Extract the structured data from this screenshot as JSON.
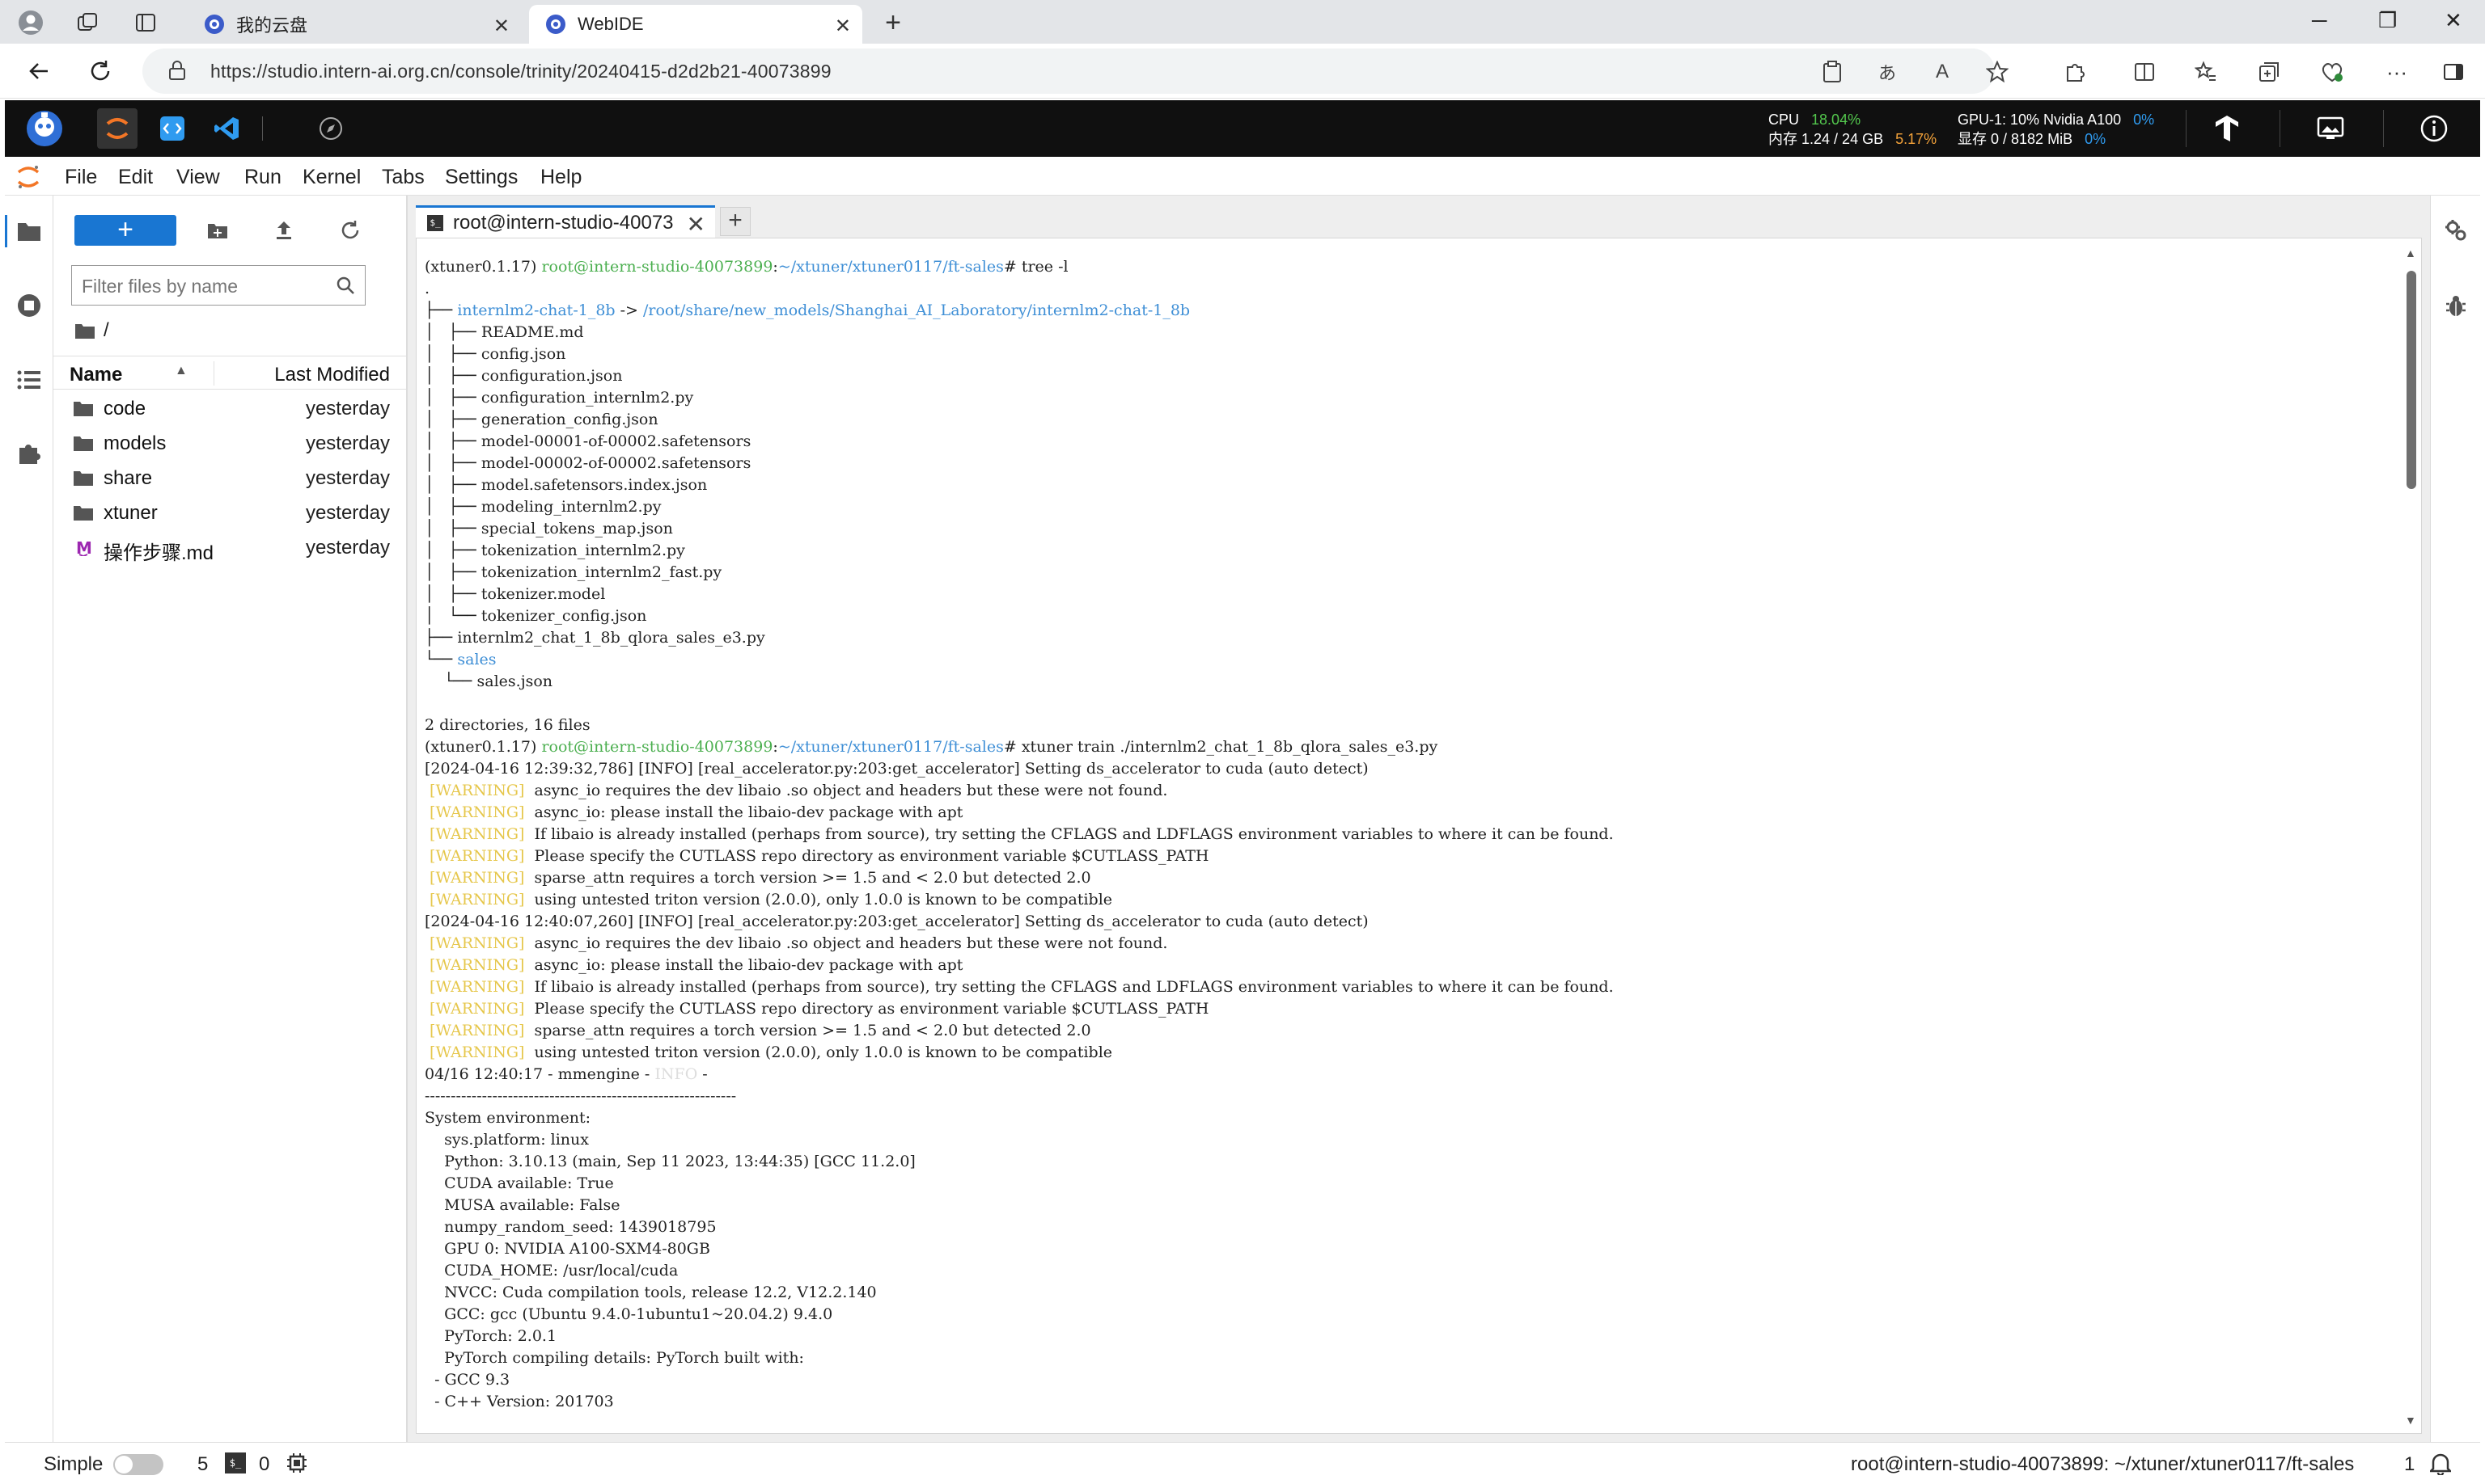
{
  "browser": {
    "tabs": [
      {
        "title": "我的云盘"
      },
      {
        "title": "WebIDE"
      }
    ],
    "url": "https://studio.intern-ai.org.cn/console/trinity/20240415-d2d2b21-40073899"
  },
  "topbar": {
    "cpu_label": "CPU",
    "cpu_value": "18.04%",
    "mem_label": "内存",
    "mem_value": "1.24 / 24 GB",
    "mem_percent": "5.17%",
    "gpu_label": "GPU-1: 10% Nvidia A100",
    "gpu_percent": "0%",
    "vram_label": "显存",
    "vram_value": "0 / 8182 MiB",
    "vram_percent": "0%"
  },
  "menu": {
    "items": [
      "File",
      "Edit",
      "View",
      "Run",
      "Kernel",
      "Tabs",
      "Settings",
      "Help"
    ]
  },
  "filebrowser": {
    "new_label": "+",
    "filter_placeholder": "Filter files by name",
    "breadcrumb": "/",
    "col_name": "Name",
    "col_modified": "Last Modified",
    "files": [
      {
        "name": "code",
        "modified": "yesterday",
        "type": "folder"
      },
      {
        "name": "models",
        "modified": "yesterday",
        "type": "folder"
      },
      {
        "name": "share",
        "modified": "yesterday",
        "type": "folder"
      },
      {
        "name": "xtuner",
        "modified": "yesterday",
        "type": "folder"
      },
      {
        "name": "操作步骤.md",
        "modified": "yesterday",
        "type": "markdown"
      }
    ]
  },
  "terminal": {
    "tab_title": "root@intern-studio-40073",
    "add_tab": "+",
    "lines": [
      {
        "segs": [
          {
            "t": "(xtuner0.1.17) "
          },
          {
            "t": "root@intern-studio-40073899",
            "c": "green"
          },
          {
            "t": ":"
          },
          {
            "t": "~/xtuner/xtuner0117/ft-sales",
            "c": "blue"
          },
          {
            "t": "# tree -l"
          }
        ]
      },
      {
        "segs": [
          {
            "t": "."
          }
        ]
      },
      {
        "segs": [
          {
            "t": "├── "
          },
          {
            "t": "internlm2-chat-1_8b",
            "c": "blue"
          },
          {
            "t": " -> "
          },
          {
            "t": "/root/share/new_models/Shanghai_AI_Laboratory/internlm2-chat-1_8b",
            "c": "blue"
          }
        ]
      },
      {
        "segs": [
          {
            "t": "│   ├── README.md"
          }
        ]
      },
      {
        "segs": [
          {
            "t": "│   ├── config.json"
          }
        ]
      },
      {
        "segs": [
          {
            "t": "│   ├── configuration.json"
          }
        ]
      },
      {
        "segs": [
          {
            "t": "│   ├── configuration_internlm2.py"
          }
        ]
      },
      {
        "segs": [
          {
            "t": "│   ├── generation_config.json"
          }
        ]
      },
      {
        "segs": [
          {
            "t": "│   ├── model-00001-of-00002.safetensors"
          }
        ]
      },
      {
        "segs": [
          {
            "t": "│   ├── model-00002-of-00002.safetensors"
          }
        ]
      },
      {
        "segs": [
          {
            "t": "│   ├── model.safetensors.index.json"
          }
        ]
      },
      {
        "segs": [
          {
            "t": "│   ├── modeling_internlm2.py"
          }
        ]
      },
      {
        "segs": [
          {
            "t": "│   ├── special_tokens_map.json"
          }
        ]
      },
      {
        "segs": [
          {
            "t": "│   ├── tokenization_internlm2.py"
          }
        ]
      },
      {
        "segs": [
          {
            "t": "│   ├── tokenization_internlm2_fast.py"
          }
        ]
      },
      {
        "segs": [
          {
            "t": "│   ├── tokenizer.model"
          }
        ]
      },
      {
        "segs": [
          {
            "t": "│   └── tokenizer_config.json"
          }
        ]
      },
      {
        "segs": [
          {
            "t": "├── internlm2_chat_1_8b_qlora_sales_e3.py"
          }
        ]
      },
      {
        "segs": [
          {
            "t": "└── "
          },
          {
            "t": "sales",
            "c": "blue"
          }
        ]
      },
      {
        "segs": [
          {
            "t": "    └── sales.json"
          }
        ]
      },
      {
        "segs": [
          {
            "t": ""
          }
        ]
      },
      {
        "segs": [
          {
            "t": "2 directories, 16 files"
          }
        ]
      },
      {
        "segs": [
          {
            "t": "(xtuner0.1.17) "
          },
          {
            "t": "root@intern-studio-40073899",
            "c": "green"
          },
          {
            "t": ":"
          },
          {
            "t": "~/xtuner/xtuner0117/ft-sales",
            "c": "blue"
          },
          {
            "t": "# xtuner train ./internlm2_chat_1_8b_qlora_sales_e3.py"
          }
        ]
      },
      {
        "segs": [
          {
            "t": "[2024-04-16 12:39:32,786] [INFO] [real_accelerator.py:203:get_accelerator] Setting ds_accelerator to cuda (auto detect)"
          }
        ]
      },
      {
        "segs": [
          {
            "t": " [WARNING]",
            "c": "yellow"
          },
          {
            "t": "  async_io requires the dev libaio .so object and headers but these were not found."
          }
        ]
      },
      {
        "segs": [
          {
            "t": " [WARNING]",
            "c": "yellow"
          },
          {
            "t": "  async_io: please install the libaio-dev package with apt"
          }
        ]
      },
      {
        "segs": [
          {
            "t": " [WARNING]",
            "c": "yellow"
          },
          {
            "t": "  If libaio is already installed (perhaps from source), try setting the CFLAGS and LDFLAGS environment variables to where it can be found."
          }
        ]
      },
      {
        "segs": [
          {
            "t": " [WARNING]",
            "c": "yellow"
          },
          {
            "t": "  Please specify the CUTLASS repo directory as environment variable $CUTLASS_PATH"
          }
        ]
      },
      {
        "segs": [
          {
            "t": " [WARNING]",
            "c": "yellow"
          },
          {
            "t": "  sparse_attn requires a torch version >= 1.5 and < 2.0 but detected 2.0"
          }
        ]
      },
      {
        "segs": [
          {
            "t": " [WARNING]",
            "c": "yellow"
          },
          {
            "t": "  using untested triton version (2.0.0), only 1.0.0 is known to be compatible"
          }
        ]
      },
      {
        "segs": [
          {
            "t": "[2024-04-16 12:40:07,260] [INFO] [real_accelerator.py:203:get_accelerator] Setting ds_accelerator to cuda (auto detect)"
          }
        ]
      },
      {
        "segs": [
          {
            "t": " [WARNING]",
            "c": "yellow"
          },
          {
            "t": "  async_io requires the dev libaio .so object and headers but these were not found."
          }
        ]
      },
      {
        "segs": [
          {
            "t": " [WARNING]",
            "c": "yellow"
          },
          {
            "t": "  async_io: please install the libaio-dev package with apt"
          }
        ]
      },
      {
        "segs": [
          {
            "t": " [WARNING]",
            "c": "yellow"
          },
          {
            "t": "  If libaio is already installed (perhaps from source), try setting the CFLAGS and LDFLAGS environment variables to where it can be found."
          }
        ]
      },
      {
        "segs": [
          {
            "t": " [WARNING]",
            "c": "yellow"
          },
          {
            "t": "  Please specify the CUTLASS repo directory as environment variable $CUTLASS_PATH"
          }
        ]
      },
      {
        "segs": [
          {
            "t": " [WARNING]",
            "c": "yellow"
          },
          {
            "t": "  sparse_attn requires a torch version >= 1.5 and < 2.0 but detected 2.0"
          }
        ]
      },
      {
        "segs": [
          {
            "t": " [WARNING]",
            "c": "yellow"
          },
          {
            "t": "  using untested triton version (2.0.0), only 1.0.0 is known to be compatible"
          }
        ]
      },
      {
        "segs": [
          {
            "t": "04/16 12:40:17 - mmengine - "
          },
          {
            "t": "INFO",
            "c": "faint"
          },
          {
            "t": " -"
          }
        ]
      },
      {
        "segs": [
          {
            "t": "------------------------------------------------------------"
          }
        ]
      },
      {
        "segs": [
          {
            "t": "System environment:"
          }
        ]
      },
      {
        "segs": [
          {
            "t": "    sys.platform: linux"
          }
        ]
      },
      {
        "segs": [
          {
            "t": "    Python: 3.10.13 (main, Sep 11 2023, 13:44:35) [GCC 11.2.0]"
          }
        ]
      },
      {
        "segs": [
          {
            "t": "    CUDA available: True"
          }
        ]
      },
      {
        "segs": [
          {
            "t": "    MUSA available: False"
          }
        ]
      },
      {
        "segs": [
          {
            "t": "    numpy_random_seed: 1439018795"
          }
        ]
      },
      {
        "segs": [
          {
            "t": "    GPU 0: NVIDIA A100-SXM4-80GB"
          }
        ]
      },
      {
        "segs": [
          {
            "t": "    CUDA_HOME: /usr/local/cuda"
          }
        ]
      },
      {
        "segs": [
          {
            "t": "    NVCC: Cuda compilation tools, release 12.2, V12.2.140"
          }
        ]
      },
      {
        "segs": [
          {
            "t": "    GCC: gcc (Ubuntu 9.4.0-1ubuntu1~20.04.2) 9.4.0"
          }
        ]
      },
      {
        "segs": [
          {
            "t": "    PyTorch: 2.0.1"
          }
        ]
      },
      {
        "segs": [
          {
            "t": "    PyTorch compiling details: PyTorch built with:"
          }
        ]
      },
      {
        "segs": [
          {
            "t": "  - GCC 9.3"
          }
        ]
      },
      {
        "segs": [
          {
            "t": "  - C++ Version: 201703"
          }
        ]
      }
    ]
  },
  "statusbar": {
    "simple_label": "Simple",
    "kernels_count": "5",
    "terminals_count": "0",
    "path": "root@intern-studio-40073899: ~/xtuner/xtuner0117/ft-sales",
    "notifications": "1"
  },
  "colors": {
    "accent": "#1976d2",
    "prompt_green": "#4caf50",
    "path_blue": "#3f8fd6",
    "warning_yellow": "#e6c74c"
  }
}
